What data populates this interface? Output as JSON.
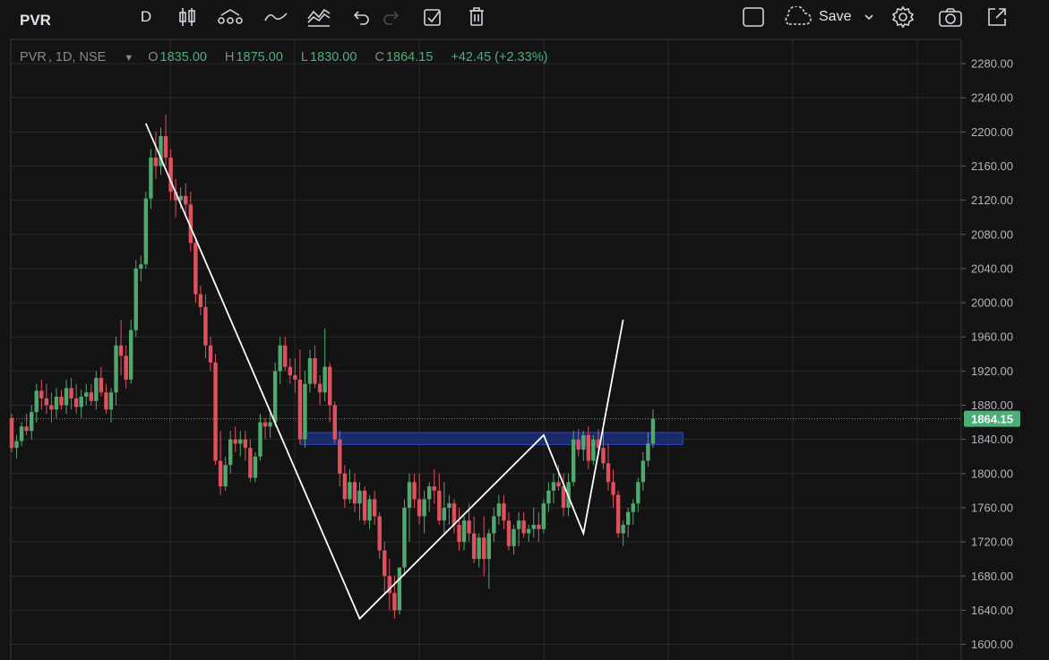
{
  "toolbar": {
    "symbol": "PVR",
    "interval": "D",
    "save_label": "Save",
    "icons": [
      "candles-icon",
      "indicators-icon",
      "compare-icon",
      "templates-icon",
      "undo-icon",
      "redo-icon",
      "checklist-icon",
      "trash-icon",
      "rectangle-icon",
      "cloud-icon",
      "chevron-down-icon",
      "gear-icon",
      "camera-icon",
      "external-icon"
    ]
  },
  "legend": {
    "title": "PVR",
    "details": ", 1D, NSE",
    "o_label": "O",
    "o": "1835.00",
    "h_label": "H",
    "h": "1875.00",
    "l_label": "L",
    "l": "1830.00",
    "c_label": "C",
    "c": "1864.15",
    "change": "+42.45 (+2.33%)"
  },
  "colors": {
    "background": "#131313",
    "up": "#4fa86e",
    "down": "#e0505f",
    "grid": "#2a2a2a",
    "zone": "#1d2d7a",
    "trendline": "#ffffff",
    "price_label": "#4caf7a"
  },
  "chart_data": {
    "type": "candlestick",
    "symbol": "PVR",
    "interval": "1D",
    "exchange": "NSE",
    "ylim": [
      1590,
      2300
    ],
    "yticks": [
      "2280.00",
      "2240.00",
      "2200.00",
      "2160.00",
      "2120.00",
      "2080.00",
      "2040.00",
      "2000.00",
      "1960.00",
      "1920.00",
      "1880.00",
      "1840.00",
      "1800.00",
      "1760.00",
      "1720.00",
      "1680.00",
      "1640.00",
      "1600.00"
    ],
    "last_price": "1864.15",
    "last_price_value": 1864.15,
    "candles": [
      [
        1865,
        1870,
        1825,
        1830
      ],
      [
        1830,
        1845,
        1818,
        1838
      ],
      [
        1838,
        1860,
        1832,
        1855
      ],
      [
        1855,
        1870,
        1845,
        1850
      ],
      [
        1850,
        1880,
        1840,
        1872
      ],
      [
        1872,
        1905,
        1860,
        1897
      ],
      [
        1897,
        1910,
        1875,
        1888
      ],
      [
        1888,
        1905,
        1870,
        1880
      ],
      [
        1880,
        1895,
        1860,
        1875
      ],
      [
        1875,
        1900,
        1865,
        1890
      ],
      [
        1890,
        1898,
        1875,
        1880
      ],
      [
        1880,
        1910,
        1870,
        1900
      ],
      [
        1900,
        1912,
        1875,
        1888
      ],
      [
        1888,
        1905,
        1870,
        1878
      ],
      [
        1878,
        1898,
        1865,
        1890
      ],
      [
        1890,
        1905,
        1880,
        1895
      ],
      [
        1895,
        1905,
        1880,
        1885
      ],
      [
        1885,
        1920,
        1875,
        1912
      ],
      [
        1912,
        1925,
        1890,
        1895
      ],
      [
        1895,
        1905,
        1870,
        1875
      ],
      [
        1875,
        1900,
        1860,
        1895
      ],
      [
        1895,
        1960,
        1880,
        1950
      ],
      [
        1950,
        1980,
        1915,
        1938
      ],
      [
        1938,
        1950,
        1900,
        1910
      ],
      [
        1910,
        1980,
        1905,
        1968
      ],
      [
        1968,
        2050,
        1960,
        2040
      ],
      [
        2040,
        2055,
        2025,
        2045
      ],
      [
        2045,
        2130,
        2040,
        2122
      ],
      [
        2122,
        2180,
        2110,
        2170
      ],
      [
        2170,
        2200,
        2145,
        2160
      ],
      [
        2160,
        2205,
        2150,
        2195
      ],
      [
        2195,
        2220,
        2160,
        2170
      ],
      [
        2170,
        2180,
        2120,
        2130
      ],
      [
        2130,
        2145,
        2100,
        2120
      ],
      [
        2120,
        2135,
        2110,
        2125
      ],
      [
        2125,
        2140,
        2100,
        2115
      ],
      [
        2115,
        2130,
        2060,
        2070
      ],
      [
        2070,
        2075,
        2000,
        2010
      ],
      [
        2010,
        2020,
        1985,
        1995
      ],
      [
        1995,
        2010,
        1935,
        1950
      ],
      [
        1950,
        1960,
        1920,
        1930
      ],
      [
        1930,
        1940,
        1810,
        1815
      ],
      [
        1815,
        1850,
        1775,
        1785
      ],
      [
        1785,
        1820,
        1780,
        1810
      ],
      [
        1810,
        1850,
        1800,
        1840
      ],
      [
        1840,
        1855,
        1825,
        1835
      ],
      [
        1835,
        1850,
        1820,
        1840
      ],
      [
        1840,
        1850,
        1815,
        1830
      ],
      [
        1830,
        1840,
        1790,
        1795
      ],
      [
        1795,
        1825,
        1790,
        1820
      ],
      [
        1820,
        1870,
        1815,
        1860
      ],
      [
        1860,
        1865,
        1840,
        1855
      ],
      [
        1855,
        1875,
        1842,
        1860
      ],
      [
        1860,
        1930,
        1855,
        1920
      ],
      [
        1920,
        1960,
        1905,
        1950
      ],
      [
        1950,
        1960,
        1920,
        1925
      ],
      [
        1925,
        1935,
        1905,
        1915
      ],
      [
        1915,
        1935,
        1895,
        1910
      ],
      [
        1910,
        1945,
        1835,
        1840
      ],
      [
        1840,
        1920,
        1830,
        1905
      ],
      [
        1905,
        1945,
        1895,
        1935
      ],
      [
        1935,
        1950,
        1900,
        1905
      ],
      [
        1905,
        1915,
        1880,
        1895
      ],
      [
        1895,
        1970,
        1885,
        1925
      ],
      [
        1925,
        1930,
        1860,
        1880
      ],
      [
        1880,
        1885,
        1835,
        1840
      ],
      [
        1840,
        1850,
        1785,
        1800
      ],
      [
        1800,
        1810,
        1760,
        1770
      ],
      [
        1770,
        1805,
        1765,
        1790
      ],
      [
        1790,
        1800,
        1755,
        1765
      ],
      [
        1765,
        1790,
        1745,
        1780
      ],
      [
        1780,
        1785,
        1740,
        1745
      ],
      [
        1745,
        1775,
        1735,
        1770
      ],
      [
        1770,
        1780,
        1740,
        1750
      ],
      [
        1750,
        1755,
        1700,
        1710
      ],
      [
        1710,
        1720,
        1660,
        1680
      ],
      [
        1680,
        1700,
        1640,
        1660
      ],
      [
        1660,
        1680,
        1630,
        1640
      ],
      [
        1640,
        1690,
        1635,
        1690
      ],
      [
        1690,
        1770,
        1680,
        1760
      ],
      [
        1760,
        1800,
        1720,
        1790
      ],
      [
        1790,
        1800,
        1760,
        1770
      ],
      [
        1770,
        1800,
        1740,
        1750
      ],
      [
        1750,
        1780,
        1730,
        1770
      ],
      [
        1770,
        1790,
        1755,
        1785
      ],
      [
        1785,
        1805,
        1765,
        1780
      ],
      [
        1780,
        1800,
        1740,
        1745
      ],
      [
        1745,
        1790,
        1730,
        1760
      ],
      [
        1760,
        1775,
        1740,
        1765
      ],
      [
        1765,
        1770,
        1730,
        1740
      ],
      [
        1740,
        1760,
        1710,
        1720
      ],
      [
        1720,
        1750,
        1710,
        1745
      ],
      [
        1745,
        1765,
        1720,
        1730
      ],
      [
        1730,
        1750,
        1695,
        1700
      ],
      [
        1700,
        1730,
        1690,
        1725
      ],
      [
        1725,
        1750,
        1680,
        1700
      ],
      [
        1700,
        1735,
        1665,
        1730
      ],
      [
        1730,
        1760,
        1720,
        1750
      ],
      [
        1750,
        1775,
        1740,
        1765
      ],
      [
        1765,
        1775,
        1735,
        1745
      ],
      [
        1745,
        1755,
        1710,
        1715
      ],
      [
        1715,
        1740,
        1705,
        1735
      ],
      [
        1735,
        1755,
        1715,
        1745
      ],
      [
        1745,
        1755,
        1725,
        1730
      ],
      [
        1730,
        1740,
        1720,
        1735
      ],
      [
        1735,
        1760,
        1725,
        1740
      ],
      [
        1740,
        1755,
        1720,
        1735
      ],
      [
        1735,
        1770,
        1730,
        1765
      ],
      [
        1765,
        1790,
        1755,
        1780
      ],
      [
        1780,
        1800,
        1765,
        1790
      ],
      [
        1790,
        1810,
        1780,
        1785
      ],
      [
        1785,
        1800,
        1750,
        1760
      ],
      [
        1760,
        1800,
        1750,
        1790
      ],
      [
        1790,
        1850,
        1785,
        1840
      ],
      [
        1840,
        1852,
        1820,
        1828
      ],
      [
        1828,
        1850,
        1815,
        1845
      ],
      [
        1845,
        1855,
        1805,
        1815
      ],
      [
        1815,
        1845,
        1810,
        1840
      ],
      [
        1840,
        1852,
        1825,
        1830
      ],
      [
        1830,
        1850,
        1805,
        1812
      ],
      [
        1812,
        1835,
        1780,
        1790
      ],
      [
        1790,
        1805,
        1760,
        1775
      ],
      [
        1775,
        1780,
        1725,
        1730
      ],
      [
        1730,
        1745,
        1715,
        1740
      ],
      [
        1740,
        1760,
        1725,
        1755
      ],
      [
        1755,
        1770,
        1740,
        1765
      ],
      [
        1765,
        1795,
        1755,
        1790
      ],
      [
        1790,
        1825,
        1780,
        1815
      ],
      [
        1815,
        1848,
        1808,
        1835
      ],
      [
        1835,
        1875,
        1830,
        1864.15
      ]
    ],
    "zone": {
      "x_start_index": 58,
      "x_end_index": 135,
      "top": 1848,
      "bottom": 1834
    },
    "trendline": [
      [
        27,
        2210
      ],
      [
        70,
        1630
      ],
      [
        92,
        1758
      ],
      [
        107,
        1845
      ],
      [
        115,
        1730
      ],
      [
        123,
        1980
      ]
    ]
  }
}
